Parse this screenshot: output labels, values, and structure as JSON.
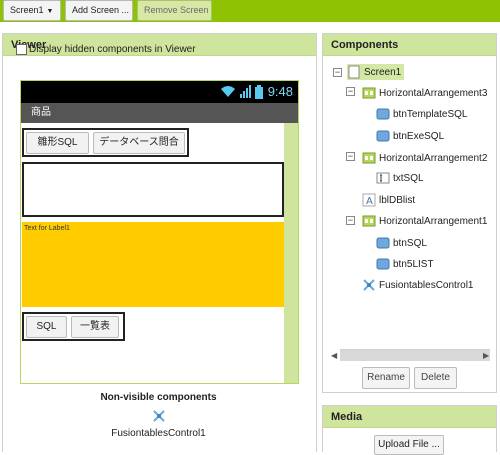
{
  "toolbar": {
    "screen_select": "Screen1",
    "add_screen": "Add Screen ...",
    "remove_screen": "Remove Screen"
  },
  "viewer": {
    "title": "Viewer",
    "hidden_checkbox_label": "Display hidden components in Viewer",
    "status_time": "9:48",
    "app_title": "商品",
    "row1": {
      "btn1": "雛形SQL",
      "btn2": "データベース問合"
    },
    "label_text": "Text for Label1",
    "row3": {
      "btn1": "SQL",
      "btn2": "一覧表"
    },
    "nonvisible_title": "Non-visible components",
    "nonvisible_item": "FusiontablesControl1"
  },
  "components": {
    "title": "Components",
    "tree": [
      {
        "label": "Screen1",
        "icon": "screen-icon"
      },
      {
        "label": "HorizontalArrangement3",
        "icon": "arrangement-icon"
      },
      {
        "label": "btnTemplateSQL",
        "icon": "button-icon"
      },
      {
        "label": "btnExeSQL",
        "icon": "button-icon"
      },
      {
        "label": "HorizontalArrangement2",
        "icon": "arrangement-icon"
      },
      {
        "label": "txtSQL",
        "icon": "textbox-icon"
      },
      {
        "label": "lblDBlist",
        "icon": "label-icon"
      },
      {
        "label": "HorizontalArrangement1",
        "icon": "arrangement-icon"
      },
      {
        "label": "btnSQL",
        "icon": "button-icon"
      },
      {
        "label": "btn5LIST",
        "icon": "button-icon"
      },
      {
        "label": "FusiontablesControl1",
        "icon": "fusiontables-icon"
      }
    ],
    "rename": "Rename",
    "delete": "Delete"
  },
  "media": {
    "title": "Media",
    "upload": "Upload File ..."
  },
  "colors": {
    "brand_green": "#8fc202",
    "panel_header": "#cfe49c",
    "label_yellow": "#ffcc00"
  }
}
